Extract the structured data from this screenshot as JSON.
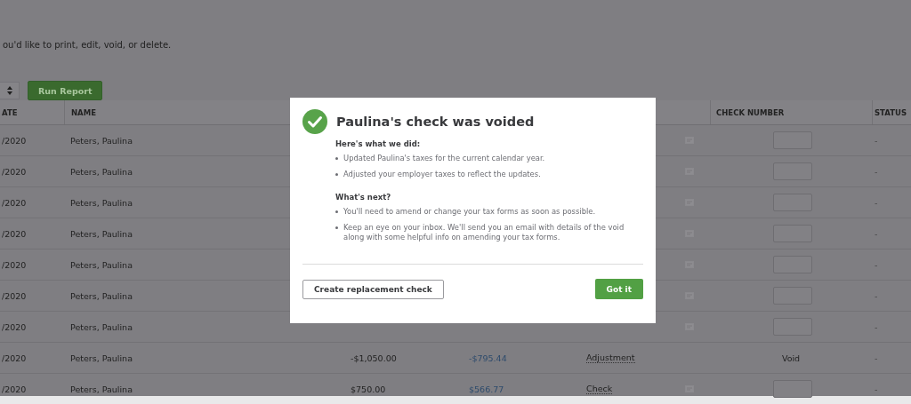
{
  "intro": "ou'd like to print, edit, void, or delete.",
  "toolbar": {
    "run_button": "Run Report"
  },
  "table": {
    "columns": [
      "ATE",
      "NAME",
      "CHECK NUMBER",
      "STATUS"
    ],
    "rows": [
      {
        "date": "/2020",
        "name": "Peters, Paulina",
        "status": "-"
      },
      {
        "date": "/2020",
        "name": "Peters, Paulina",
        "status": "-"
      },
      {
        "date": "/2020",
        "name": "Peters, Paulina",
        "status": "-"
      },
      {
        "date": "/2020",
        "name": "Peters, Paulina",
        "status": "-"
      },
      {
        "date": "/2020",
        "name": "Peters, Paulina",
        "status": "-"
      },
      {
        "date": "/2020",
        "name": "Peters, Paulina",
        "status": "-"
      },
      {
        "date": "/2020",
        "name": "Peters, Paulina",
        "status": "-"
      },
      {
        "date": "/2020",
        "name": "Peters, Paulina",
        "gross": "-$1,050.00",
        "net": "-$795.44",
        "type": "Adjustment",
        "check_number": "Void",
        "status": "-"
      },
      {
        "date": "/2020",
        "name": "Peters, Paulina",
        "gross": "$750.00",
        "net": "$566.77",
        "type": "Check",
        "status": "-"
      }
    ]
  },
  "dialog": {
    "title": "Paulina's check was voided",
    "sections": [
      {
        "heading": "Here's what we did:",
        "items": [
          "Updated Paulina's taxes for the current calendar year.",
          "Adjusted your employer taxes to reflect the updates."
        ]
      },
      {
        "heading": "What's next?",
        "items": [
          "You'll need to amend or change your tax forms as soon as possible.",
          "Keep an eye on your inbox. We'll send you an email with details of the void along with some helpful info on amending your tax forms."
        ]
      }
    ],
    "secondary_button": "Create replacement check",
    "primary_button": "Got it"
  }
}
